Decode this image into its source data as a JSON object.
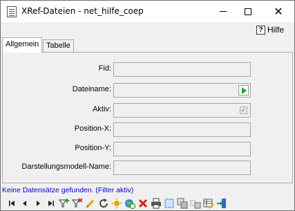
{
  "window": {
    "title": "XRef-Dateien - net_hilfe_coep",
    "minimize_label": "",
    "maximize_label": "",
    "close_label": "✕"
  },
  "helpbar": {
    "help_label": "Hilfe",
    "help_icon_glyph": "?"
  },
  "tabs": [
    {
      "label": "Allgemein",
      "active": true
    },
    {
      "label": "Tabelle",
      "active": false
    }
  ],
  "form": {
    "fields": [
      {
        "label": "Fid:",
        "value": ""
      },
      {
        "label": "Dateiname:",
        "value": ""
      },
      {
        "label": "Aktiv:",
        "value": ""
      },
      {
        "label": "Position-X:",
        "value": ""
      },
      {
        "label": "Position-Y:",
        "value": ""
      },
      {
        "label": "Darstellungsmodell-Name:",
        "value": ""
      }
    ]
  },
  "status": {
    "text": "Keine Datensätze gefunden. (Filter aktiv)",
    "color": "#0000cc"
  },
  "toolbar": {
    "icons": [
      "first-record-icon",
      "previous-record-icon",
      "next-record-icon",
      "last-record-icon",
      "add-filter-icon",
      "remove-filter-icon",
      "edit-icon",
      "refresh-icon",
      "highlight-icon",
      "globe-refresh-icon",
      "delete-icon",
      "print-icon",
      "select-icon",
      "copy-icon",
      "move-icon",
      "table-edit-icon",
      "exit-icon"
    ]
  },
  "colors": {
    "accent_green": "#1aa71a",
    "delete_red": "#d42020",
    "status_blue": "#0000cc"
  }
}
